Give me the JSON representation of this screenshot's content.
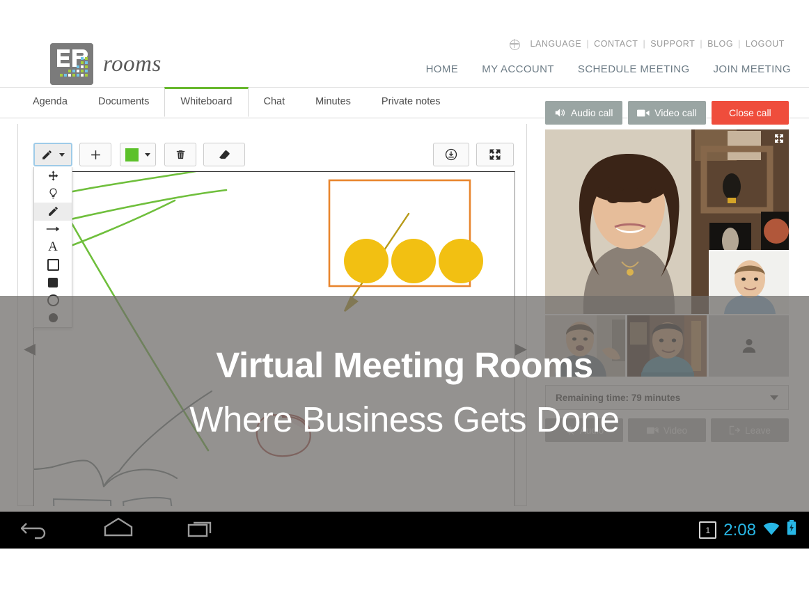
{
  "header": {
    "logo_text": "rooms",
    "logo_mark_label": "3P",
    "util_links": [
      "LANGUAGE",
      "CONTACT",
      "SUPPORT",
      "BLOG",
      "LOGOUT"
    ],
    "globe_icon": "globe-icon",
    "main_nav": [
      "HOME",
      "MY ACCOUNT",
      "SCHEDULE MEETING",
      "JOIN MEETING"
    ]
  },
  "tabs": [
    {
      "label": "Agenda",
      "active": false
    },
    {
      "label": "Documents",
      "active": false
    },
    {
      "label": "Whiteboard",
      "active": true
    },
    {
      "label": "Chat",
      "active": false
    },
    {
      "label": "Minutes",
      "active": false
    },
    {
      "label": "Private notes",
      "active": false
    }
  ],
  "whiteboard": {
    "toolbar": {
      "pencil_tool": "pencil-icon",
      "add_tool": "plus-icon",
      "color_tool": "color-swatch",
      "color_value": "#5cc12a",
      "delete_tool": "trash-icon",
      "eraser_tool": "eraser-icon",
      "download_tool": "download-icon",
      "fullscreen_tool": "fullscreen-icon"
    },
    "tool_menu": [
      {
        "name": "move-tool",
        "icon": "move-arrows-icon",
        "selected": false
      },
      {
        "name": "pin-tool",
        "icon": "lightbulb-icon",
        "selected": false
      },
      {
        "name": "pencil-tool",
        "icon": "pencil-icon",
        "selected": true
      },
      {
        "name": "arrow-tool",
        "icon": "arrow-right-icon",
        "selected": false
      },
      {
        "name": "text-tool",
        "icon": "text-a-icon",
        "selected": false
      },
      {
        "name": "rect-outline-tool",
        "icon": "square-outline-icon",
        "selected": false
      },
      {
        "name": "rect-filled-tool",
        "icon": "square-filled-icon",
        "selected": false
      },
      {
        "name": "circle-outline-tool",
        "icon": "circle-outline-icon",
        "selected": false
      },
      {
        "name": "circle-filled-tool",
        "icon": "circle-filled-icon",
        "selected": false
      }
    ],
    "nav_prev": "◀",
    "nav_next": "▶",
    "drawing": {
      "green_stroke": "#6fbf3c",
      "orange_rect_stroke": "#e8852d",
      "yellow_fill": "#f2c012",
      "gray_stroke": "#6f7b7d",
      "red_stroke": "#a84a41",
      "gold_stroke": "#b79a18"
    }
  },
  "call": {
    "buttons": [
      {
        "label": "Audio call",
        "icon": "speaker-icon",
        "style": "gray"
      },
      {
        "label": "Video call",
        "icon": "camera-icon",
        "style": "gray"
      },
      {
        "label": "Close call",
        "icon": "",
        "style": "red"
      }
    ],
    "expand_icon": "fullscreen-icon",
    "empty_slot_icon": "person-placeholder-icon",
    "remaining_time": "Remaining time: 79 minutes",
    "remaining_chevron": "chevron-down-icon",
    "controls": [
      {
        "label": "Audio",
        "icon": "mic-muted-icon"
      },
      {
        "label": "Video",
        "icon": "camera-off-icon"
      },
      {
        "label": "Leave",
        "icon": "exit-icon"
      }
    ]
  },
  "marketing": {
    "line1": "Virtual Meeting Rooms",
    "line2": "Where Business Gets Done"
  },
  "android": {
    "back_icon": "back-arrow-icon",
    "home_icon": "home-icon",
    "recents_icon": "recents-icon",
    "notification_count": "1",
    "time": "2:08",
    "wifi_icon": "wifi-icon",
    "battery_icon": "battery-charging-icon"
  }
}
